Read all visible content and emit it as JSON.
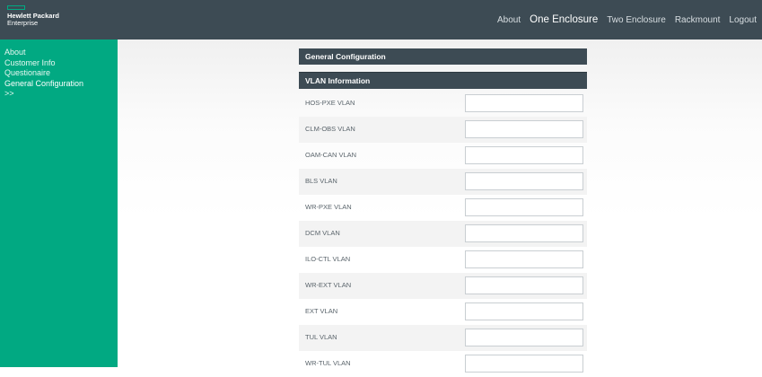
{
  "brand": {
    "line1": "Hewlett Packard",
    "line2": "Enterprise"
  },
  "topnav": {
    "items": [
      {
        "label": "About",
        "active": false
      },
      {
        "label": "One Enclosure",
        "active": true
      },
      {
        "label": "Two Enclosure",
        "active": false
      },
      {
        "label": "Rackmount",
        "active": false
      },
      {
        "label": "Logout",
        "active": false
      }
    ]
  },
  "sidebar": {
    "items": [
      {
        "label": "About"
      },
      {
        "label": "Customer Info"
      },
      {
        "label": "Questionaire"
      },
      {
        "label": "General Configuration"
      },
      {
        "label": ">>"
      }
    ]
  },
  "sections": {
    "general": "General Configuration",
    "vlan": "VLAN Information"
  },
  "vlan_fields": [
    {
      "label": "HOS-PXE VLAN",
      "value": ""
    },
    {
      "label": "CLM-OBS VLAN",
      "value": ""
    },
    {
      "label": "OAM-CAN VLAN",
      "value": ""
    },
    {
      "label": "BLS VLAN",
      "value": ""
    },
    {
      "label": "WR-PXE VLAN",
      "value": ""
    },
    {
      "label": "DCM VLAN",
      "value": ""
    },
    {
      "label": "ILO-CTL VLAN",
      "value": ""
    },
    {
      "label": "WR-EXT VLAN",
      "value": ""
    },
    {
      "label": "EXT VLAN",
      "value": ""
    },
    {
      "label": "TUL VLAN",
      "value": ""
    },
    {
      "label": "WR-TUL VLAN",
      "value": ""
    }
  ],
  "colors": {
    "topbar": "#3d4b54",
    "sidebar": "#01a982",
    "section_header": "#3d4b54"
  }
}
